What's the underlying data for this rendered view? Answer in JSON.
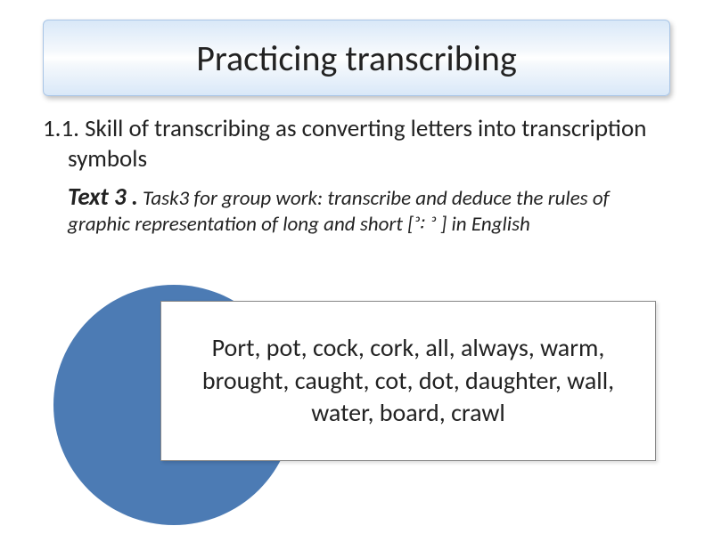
{
  "title": "Practicing transcribing",
  "skill": "1.1. Skill of transcribing as converting letters into transcription symbols",
  "text_label": "Text  3 .",
  "task_desc": " Task3 for group work: transcribe and  deduce the rules of graphic representation of long and short [ᵓ꞉ ᵓ ]  in English",
  "words": "Port, pot, cock, cork, all, always,  warm,  brought, caught, cot, dot, daughter, wall, water, board, crawl"
}
